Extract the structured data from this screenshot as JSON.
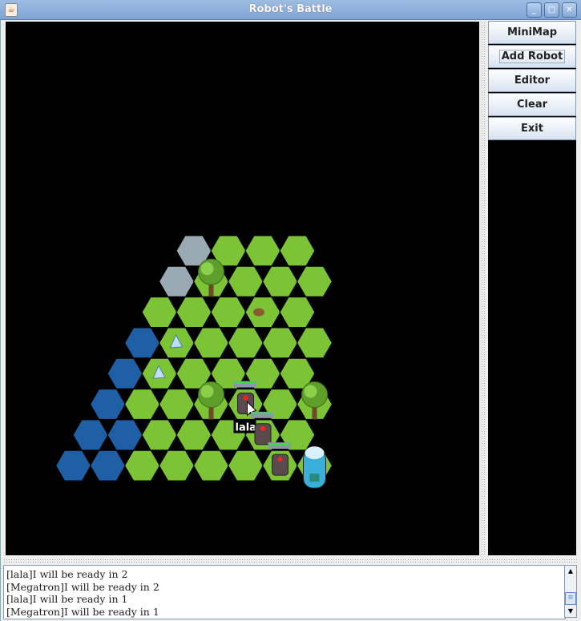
{
  "window": {
    "title": "Robot's Battle",
    "app_icon": "java-cup-icon",
    "controls": [
      "minimize-icon",
      "maximize-icon",
      "close-icon"
    ]
  },
  "sidebar": {
    "buttons": [
      {
        "label": "MiniMap"
      },
      {
        "label": "Add Robot",
        "focused": true
      },
      {
        "label": "Editor"
      },
      {
        "label": "Clear"
      },
      {
        "label": "Exit"
      }
    ]
  },
  "map": {
    "terrain_colors": {
      "grass": "#7cc436",
      "water": "#1e5fa6",
      "stone": "#9aaab4"
    },
    "rows": [
      [
        "stone",
        "grass",
        "grass",
        "grass"
      ],
      [
        "stone",
        "grass",
        "grass",
        "grass",
        "grass"
      ],
      [
        "grass",
        "grass",
        "grass",
        "grass",
        "grass"
      ],
      [
        "water",
        "grass",
        "grass",
        "grass",
        "grass",
        "grass"
      ],
      [
        "water",
        "grass",
        "grass",
        "grass",
        "grass",
        "grass"
      ],
      [
        "water",
        "grass",
        "grass",
        "grass",
        "grass",
        "grass",
        "grass"
      ],
      [
        "water",
        "water",
        "grass",
        "grass",
        "grass",
        "grass",
        "grass"
      ],
      [
        "water",
        "water",
        "grass",
        "grass",
        "grass",
        "grass",
        "grass",
        "grass"
      ]
    ],
    "objects": [
      {
        "type": "tree",
        "row": 1,
        "col": 1
      },
      {
        "type": "rock",
        "row": 2,
        "col": 3
      },
      {
        "type": "crystal",
        "row": 3,
        "col": 1
      },
      {
        "type": "crystal",
        "row": 4,
        "col": 1
      },
      {
        "type": "tree",
        "row": 5,
        "col": 3
      },
      {
        "type": "tree",
        "row": 5,
        "col": 6
      },
      {
        "type": "capsule",
        "row": 7,
        "col": 7
      }
    ],
    "robots": [
      {
        "row": 5,
        "col": 4,
        "health": 1.0,
        "label": "lala"
      },
      {
        "row": 6,
        "col": 5,
        "health": 1.0
      },
      {
        "row": 7,
        "col": 6,
        "health": 1.0
      }
    ]
  },
  "log": {
    "lines": [
      "[lala]I will be ready in 2",
      "[Megatron]I will be ready in 2",
      "[lala]I will be ready in 1",
      "[Megatron]I will be ready in 1"
    ]
  }
}
